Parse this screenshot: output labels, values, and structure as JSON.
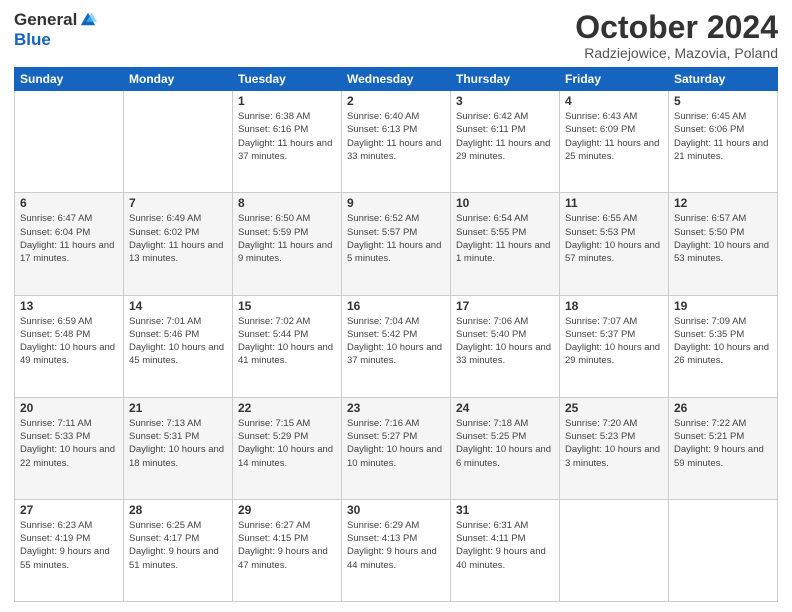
{
  "header": {
    "logo_general": "General",
    "logo_blue": "Blue",
    "month_title": "October 2024",
    "location": "Radziejowice, Mazovia, Poland"
  },
  "days_of_week": [
    "Sunday",
    "Monday",
    "Tuesday",
    "Wednesday",
    "Thursday",
    "Friday",
    "Saturday"
  ],
  "weeks": [
    [
      {
        "day": "",
        "info": ""
      },
      {
        "day": "",
        "info": ""
      },
      {
        "day": "1",
        "info": "Sunrise: 6:38 AM\nSunset: 6:16 PM\nDaylight: 11 hours and 37 minutes."
      },
      {
        "day": "2",
        "info": "Sunrise: 6:40 AM\nSunset: 6:13 PM\nDaylight: 11 hours and 33 minutes."
      },
      {
        "day": "3",
        "info": "Sunrise: 6:42 AM\nSunset: 6:11 PM\nDaylight: 11 hours and 29 minutes."
      },
      {
        "day": "4",
        "info": "Sunrise: 6:43 AM\nSunset: 6:09 PM\nDaylight: 11 hours and 25 minutes."
      },
      {
        "day": "5",
        "info": "Sunrise: 6:45 AM\nSunset: 6:06 PM\nDaylight: 11 hours and 21 minutes."
      }
    ],
    [
      {
        "day": "6",
        "info": "Sunrise: 6:47 AM\nSunset: 6:04 PM\nDaylight: 11 hours and 17 minutes."
      },
      {
        "day": "7",
        "info": "Sunrise: 6:49 AM\nSunset: 6:02 PM\nDaylight: 11 hours and 13 minutes."
      },
      {
        "day": "8",
        "info": "Sunrise: 6:50 AM\nSunset: 5:59 PM\nDaylight: 11 hours and 9 minutes."
      },
      {
        "day": "9",
        "info": "Sunrise: 6:52 AM\nSunset: 5:57 PM\nDaylight: 11 hours and 5 minutes."
      },
      {
        "day": "10",
        "info": "Sunrise: 6:54 AM\nSunset: 5:55 PM\nDaylight: 11 hours and 1 minute."
      },
      {
        "day": "11",
        "info": "Sunrise: 6:55 AM\nSunset: 5:53 PM\nDaylight: 10 hours and 57 minutes."
      },
      {
        "day": "12",
        "info": "Sunrise: 6:57 AM\nSunset: 5:50 PM\nDaylight: 10 hours and 53 minutes."
      }
    ],
    [
      {
        "day": "13",
        "info": "Sunrise: 6:59 AM\nSunset: 5:48 PM\nDaylight: 10 hours and 49 minutes."
      },
      {
        "day": "14",
        "info": "Sunrise: 7:01 AM\nSunset: 5:46 PM\nDaylight: 10 hours and 45 minutes."
      },
      {
        "day": "15",
        "info": "Sunrise: 7:02 AM\nSunset: 5:44 PM\nDaylight: 10 hours and 41 minutes."
      },
      {
        "day": "16",
        "info": "Sunrise: 7:04 AM\nSunset: 5:42 PM\nDaylight: 10 hours and 37 minutes."
      },
      {
        "day": "17",
        "info": "Sunrise: 7:06 AM\nSunset: 5:40 PM\nDaylight: 10 hours and 33 minutes."
      },
      {
        "day": "18",
        "info": "Sunrise: 7:07 AM\nSunset: 5:37 PM\nDaylight: 10 hours and 29 minutes."
      },
      {
        "day": "19",
        "info": "Sunrise: 7:09 AM\nSunset: 5:35 PM\nDaylight: 10 hours and 26 minutes."
      }
    ],
    [
      {
        "day": "20",
        "info": "Sunrise: 7:11 AM\nSunset: 5:33 PM\nDaylight: 10 hours and 22 minutes."
      },
      {
        "day": "21",
        "info": "Sunrise: 7:13 AM\nSunset: 5:31 PM\nDaylight: 10 hours and 18 minutes."
      },
      {
        "day": "22",
        "info": "Sunrise: 7:15 AM\nSunset: 5:29 PM\nDaylight: 10 hours and 14 minutes."
      },
      {
        "day": "23",
        "info": "Sunrise: 7:16 AM\nSunset: 5:27 PM\nDaylight: 10 hours and 10 minutes."
      },
      {
        "day": "24",
        "info": "Sunrise: 7:18 AM\nSunset: 5:25 PM\nDaylight: 10 hours and 6 minutes."
      },
      {
        "day": "25",
        "info": "Sunrise: 7:20 AM\nSunset: 5:23 PM\nDaylight: 10 hours and 3 minutes."
      },
      {
        "day": "26",
        "info": "Sunrise: 7:22 AM\nSunset: 5:21 PM\nDaylight: 9 hours and 59 minutes."
      }
    ],
    [
      {
        "day": "27",
        "info": "Sunrise: 6:23 AM\nSunset: 4:19 PM\nDaylight: 9 hours and 55 minutes."
      },
      {
        "day": "28",
        "info": "Sunrise: 6:25 AM\nSunset: 4:17 PM\nDaylight: 9 hours and 51 minutes."
      },
      {
        "day": "29",
        "info": "Sunrise: 6:27 AM\nSunset: 4:15 PM\nDaylight: 9 hours and 47 minutes."
      },
      {
        "day": "30",
        "info": "Sunrise: 6:29 AM\nSunset: 4:13 PM\nDaylight: 9 hours and 44 minutes."
      },
      {
        "day": "31",
        "info": "Sunrise: 6:31 AM\nSunset: 4:11 PM\nDaylight: 9 hours and 40 minutes."
      },
      {
        "day": "",
        "info": ""
      },
      {
        "day": "",
        "info": ""
      }
    ]
  ]
}
